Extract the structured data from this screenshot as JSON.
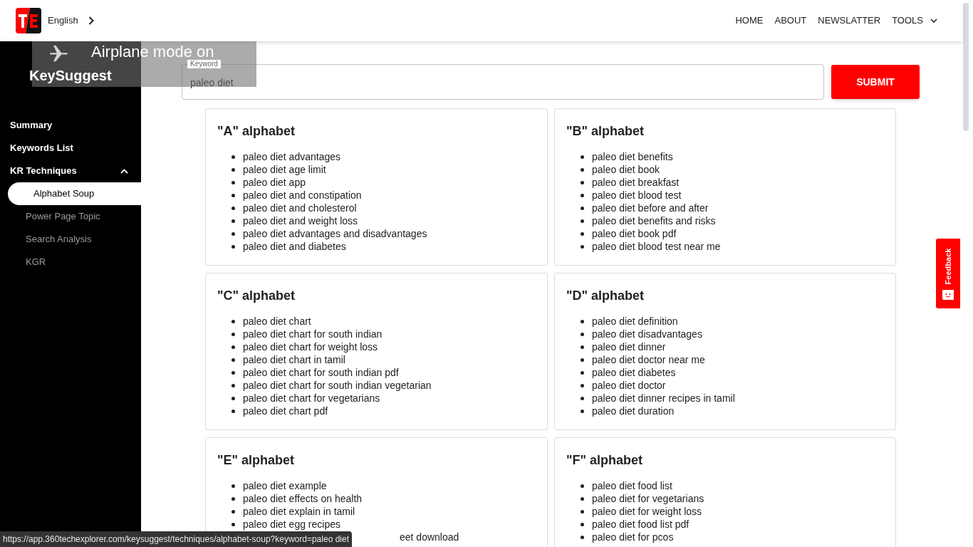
{
  "header": {
    "language": "English",
    "nav": [
      {
        "label": "HOME",
        "kind": "link"
      },
      {
        "label": "ABOUT",
        "kind": "link"
      },
      {
        "label": "NEWSLATTER",
        "kind": "link"
      },
      {
        "label": "TOOLS",
        "kind": "dropdown"
      }
    ]
  },
  "sidebar": {
    "title": "KeySuggest",
    "items": [
      {
        "label": "Summary",
        "selected": false
      },
      {
        "label": "Keywords List",
        "selected": false
      },
      {
        "label": "KR Techniques",
        "selected": false,
        "expanded": true,
        "children": [
          {
            "label": "Alphabet Soup",
            "selected": true
          },
          {
            "label": "Power Page Topic",
            "selected": false
          },
          {
            "label": "Search Analysis",
            "selected": false
          },
          {
            "label": "KGR",
            "selected": false
          }
        ]
      }
    ]
  },
  "search": {
    "label": "Keyword",
    "value": "paleo diet",
    "button": "SUBMIT"
  },
  "cards": [
    {
      "title": "\"A\" alphabet",
      "items": [
        {
          "text": "paleo diet advantages"
        },
        {
          "text": "paleo diet age limit"
        },
        {
          "text": "paleo diet app"
        },
        {
          "text": "paleo diet and constipation"
        },
        {
          "text": "paleo diet and cholesterol"
        },
        {
          "text": "paleo diet and weight loss"
        },
        {
          "text": "paleo diet advantages and disadvantages"
        },
        {
          "text": "paleo diet and diabetes"
        }
      ]
    },
    {
      "title": "\"B\" alphabet",
      "items": [
        {
          "text": "paleo diet benefits"
        },
        {
          "text": "paleo diet book"
        },
        {
          "text": "paleo diet breakfast"
        },
        {
          "text": "paleo diet blood test"
        },
        {
          "text": "paleo diet before and after"
        },
        {
          "text": "paleo diet benefits and risks"
        },
        {
          "text": "paleo diet book pdf"
        },
        {
          "text": "paleo diet blood test near me"
        }
      ]
    },
    {
      "title": "\"C\" alphabet",
      "items": [
        {
          "text": "paleo diet chart"
        },
        {
          "text": "paleo diet chart for south indian"
        },
        {
          "text": "paleo diet chart for weight loss"
        },
        {
          "text": "paleo diet chart in tamil"
        },
        {
          "text": "paleo diet chart for south indian pdf"
        },
        {
          "text": "paleo diet chart for south indian vegetarian"
        },
        {
          "text": "paleo diet chart for vegetarians"
        },
        {
          "text": "paleo diet chart pdf"
        }
      ]
    },
    {
      "title": "\"D\" alphabet",
      "items": [
        {
          "text": "paleo diet definition"
        },
        {
          "text": "paleo diet disadvantages"
        },
        {
          "text": "paleo diet dinner"
        },
        {
          "text": "paleo diet doctor near me"
        },
        {
          "text": "paleo diet diabetes"
        },
        {
          "text": "paleo diet doctor"
        },
        {
          "text": "paleo diet dinner recipes in tamil"
        },
        {
          "text": "paleo diet duration"
        }
      ]
    },
    {
      "title": "\"E\" alphabet",
      "items": [
        {
          "text": "paleo diet example"
        },
        {
          "text": "paleo diet effects on health"
        },
        {
          "text": "paleo diet explain in tamil"
        },
        {
          "text": "paleo diet egg recipes"
        },
        {
          "text": "eet download",
          "kind": "covered"
        }
      ]
    },
    {
      "title": "\"F\" alphabet",
      "items": [
        {
          "text": "paleo diet food list"
        },
        {
          "text": "paleo diet for vegetarians"
        },
        {
          "text": "paleo diet for weight loss"
        },
        {
          "text": "paleo diet food list pdf"
        },
        {
          "text": "paleo diet for pcos"
        }
      ]
    }
  ],
  "feedback": {
    "label": "Feedback"
  },
  "toast": {
    "text": "Airplane mode on"
  },
  "status_url": "https://app.360techexplorer.com/keysuggest/techniques/alphabet-soup?keyword=paleo diet"
}
